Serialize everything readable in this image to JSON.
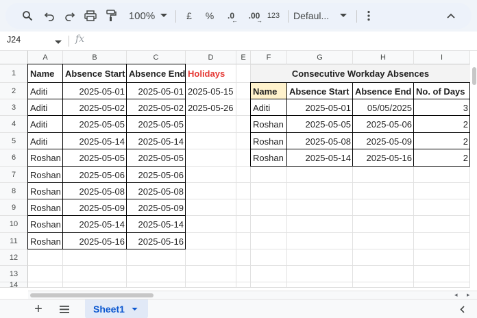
{
  "toolbar": {
    "zoom": "100%",
    "currency": "£",
    "percent": "%",
    "dec_decrease": ".0",
    "dec_increase": ".00",
    "number_format": "123",
    "font": "Defaul..."
  },
  "formula_bar": {
    "cell_ref": "J24",
    "fx": "fx"
  },
  "columns": [
    "A",
    "B",
    "C",
    "D",
    "E",
    "F",
    "G",
    "H",
    "I"
  ],
  "rows": [
    "1",
    "2",
    "3",
    "4",
    "5",
    "6",
    "7",
    "8",
    "9",
    "10",
    "11",
    "12",
    "13",
    "14"
  ],
  "sheet": {
    "left_headers": [
      "Name",
      "Absence Start",
      "Absence End"
    ],
    "left_rows": [
      [
        "Aditi",
        "2025-05-01",
        "2025-05-01"
      ],
      [
        "Aditi",
        "2025-05-02",
        "2025-05-02"
      ],
      [
        "Aditi",
        "2025-05-05",
        "2025-05-05"
      ],
      [
        "Aditi",
        "2025-05-14",
        "2025-05-14"
      ],
      [
        "Roshan",
        "2025-05-05",
        "2025-05-05"
      ],
      [
        "Roshan",
        "2025-05-06",
        "2025-05-06"
      ],
      [
        "Roshan",
        "2025-05-08",
        "2025-05-08"
      ],
      [
        "Roshan",
        "2025-05-09",
        "2025-05-09"
      ],
      [
        "Roshan",
        "2025-05-14",
        "2025-05-14"
      ],
      [
        "Roshan",
        "2025-05-16",
        "2025-05-16"
      ]
    ],
    "holidays_header": "Holidays",
    "holidays": [
      "2025-05-15",
      "2025-05-26"
    ],
    "right_title": "Consecutive Workday Absences",
    "right_headers": [
      "Name",
      "Absence Start",
      "Absence End",
      "No. of Days"
    ],
    "right_rows": [
      [
        "Aditi",
        "2025-05-01",
        "05/05/2025",
        "3"
      ],
      [
        "Roshan",
        "2025-05-05",
        "2025-05-06",
        "2"
      ],
      [
        "Roshan",
        "2025-05-08",
        "2025-05-09",
        "2"
      ],
      [
        "Roshan",
        "2025-05-14",
        "2025-05-16",
        "2"
      ]
    ]
  },
  "sheet_tabs": {
    "add": "+",
    "active": "Sheet1"
  },
  "colors": {
    "holiday_red": "#e53935",
    "name_header_yellow": "#fff2cc",
    "title_gray": "#f3f3f3",
    "sheet_tab_blue": "#0b57d0"
  }
}
